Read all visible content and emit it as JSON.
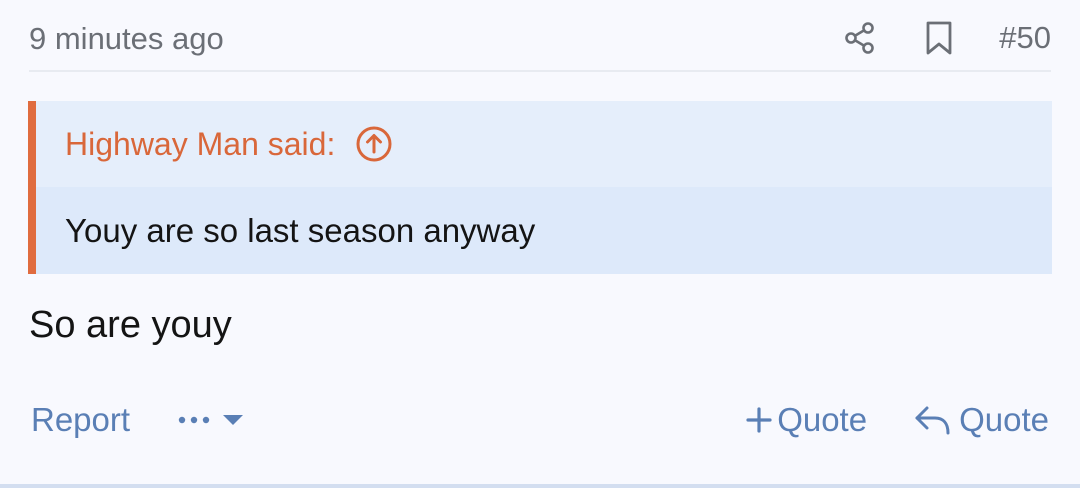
{
  "post": {
    "timestamp": "9 minutes ago",
    "number": "#50",
    "share_icon": "share-icon",
    "bookmark_icon": "bookmark-icon"
  },
  "quote": {
    "author_label": "Highway Man said:",
    "jump_icon": "arrow-up-circle-icon",
    "text": "Youy are so last season anyway",
    "accent_color": "#e06c3f"
  },
  "message": {
    "text": "So are youy"
  },
  "footer": {
    "report_label": "Report",
    "more_icon": "ellipsis-icon",
    "multiquote_label": "Quote",
    "reply_label": "Quote",
    "link_color": "#5a7fb5"
  }
}
